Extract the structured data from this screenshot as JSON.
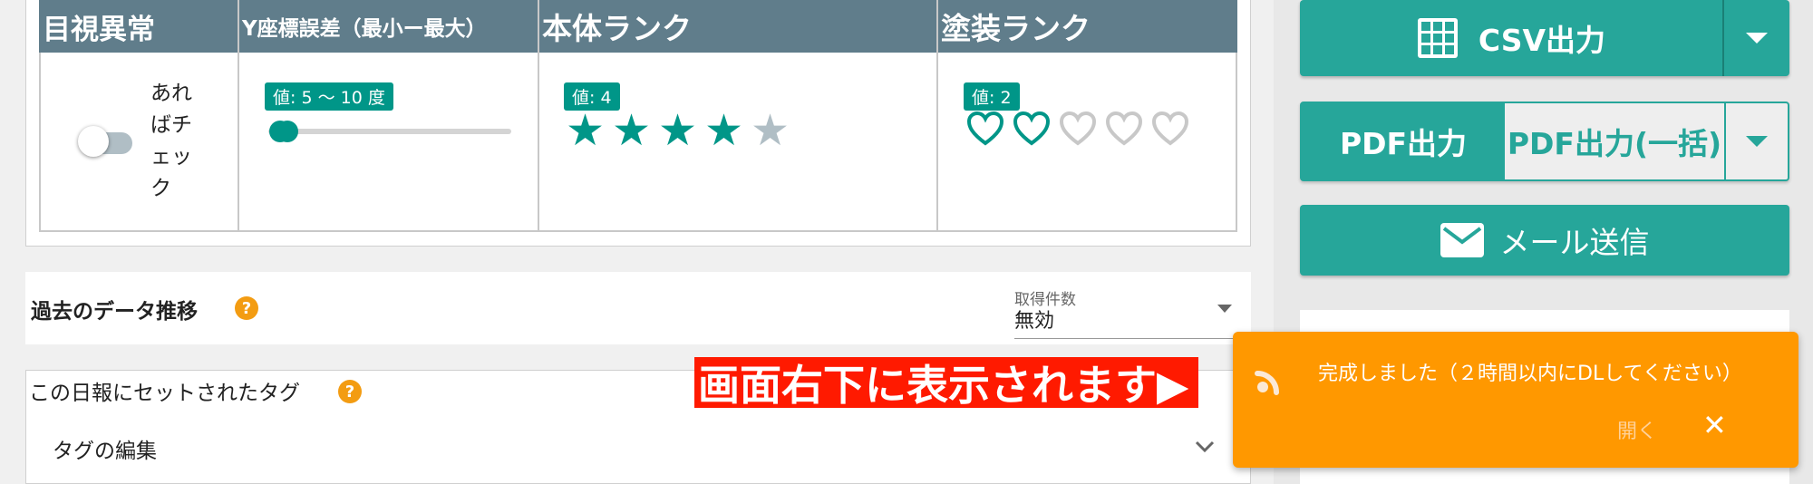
{
  "table": {
    "headers": {
      "visual": "目視異常",
      "y_error": "Y座標誤差（最小ー最大）",
      "body_rank": "本体ランク",
      "paint_rank": "塗装ランク"
    },
    "visual_check_label": [
      "あれ",
      "ばチ",
      "ェッ",
      "ク"
    ],
    "y_error_badge": "値: 5 〜 10 度",
    "y_error_range": [
      5,
      10
    ],
    "body_rank_badge": "値: 4",
    "body_rank_value": 4,
    "body_rank_max": 5,
    "paint_rank_badge": "値: 2",
    "paint_rank_value": 2,
    "paint_rank_max": 5
  },
  "history": {
    "title": "過去のデータ推移",
    "help": "?",
    "fetch_label": "取得件数",
    "fetch_value": "無効"
  },
  "tags": {
    "title": "この日報にセットされたタグ",
    "help": "?",
    "edit_label": "タグの編集"
  },
  "sidebar": {
    "csv_label": "CSV出力",
    "pdf_label": "PDF出力",
    "pdf_bulk_label": "PDF出力(一括)",
    "mail_label": "メール送信"
  },
  "banner": "画面右下に表示されます▶",
  "toast": {
    "message": "完成しました（２時間以内にDLしてください）",
    "open_label": "開く",
    "close_glyph": "✕"
  },
  "colors": {
    "teal": "#26a69a",
    "header": "#607d8b",
    "toast": "#ff9800",
    "banner": "#ff1a00"
  }
}
